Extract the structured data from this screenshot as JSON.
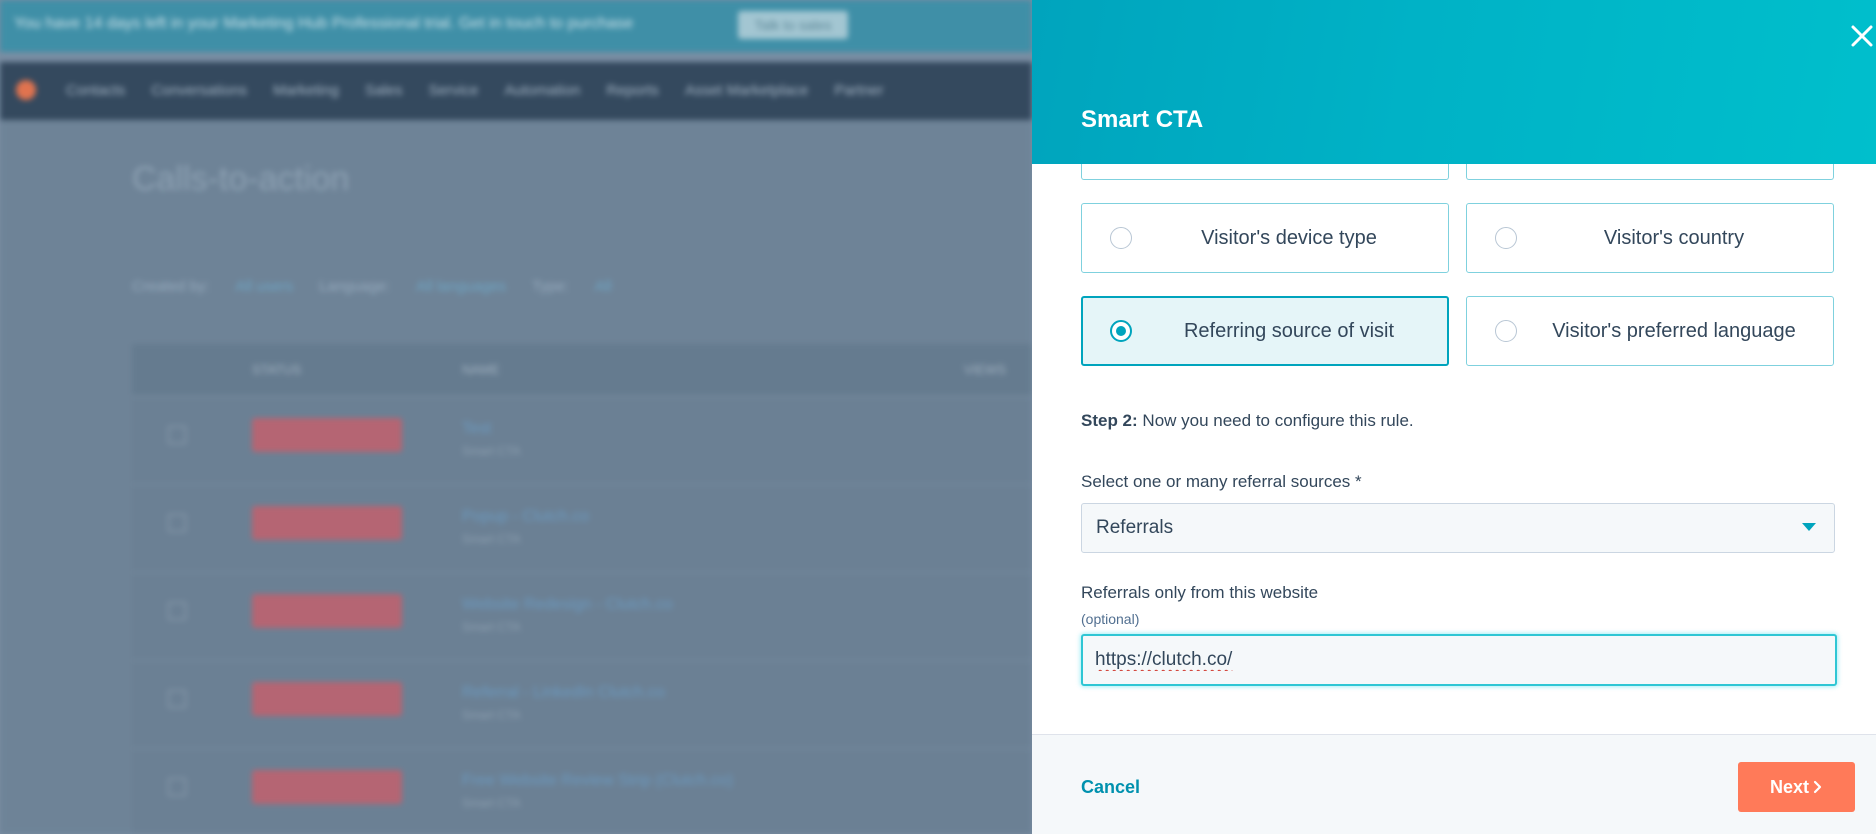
{
  "background": {
    "banner_text": "You have 14 days left in your Marketing Hub Professional trial. Get in touch to purchase",
    "banner_button": "Talk to sales",
    "nav_items": [
      "Contacts",
      "Conversations",
      "Marketing",
      "Sales",
      "Service",
      "Automation",
      "Reports",
      "Asset Marketplace",
      "Partner"
    ],
    "page_title": "Calls-to-action",
    "filters": [
      "Created by:",
      "All users",
      "Language:",
      "All languages",
      "Type:",
      "All"
    ],
    "table_headers": [
      "STATUS",
      "NAME",
      "VIEWS"
    ],
    "rows": [
      {
        "name": "Test",
        "sub": "Smart CTA"
      },
      {
        "name": "Popup - Clutch.co",
        "sub": "Smart CTA"
      },
      {
        "name": "Website Redesign - Clutch.co",
        "sub": "Smart CTA"
      },
      {
        "name": "Referral - LinkedIn Clutch.co",
        "sub": "Smart CTA"
      },
      {
        "name": "Free Website Review Strip (Clutch.co)",
        "sub": "Smart CTA"
      }
    ]
  },
  "panel": {
    "title": "Smart CTA",
    "close_icon": "close-icon",
    "rule_options": [
      {
        "label": "",
        "selected": false
      },
      {
        "label": "",
        "selected": false
      },
      {
        "label": "Visitor's device type",
        "selected": false
      },
      {
        "label": "Visitor's country",
        "selected": false
      },
      {
        "label": "Referring source of visit",
        "selected": true
      },
      {
        "label": "Visitor's preferred language",
        "selected": false
      }
    ],
    "step2": {
      "prefix": "Step 2:",
      "text": " Now you need to configure this rule."
    },
    "referral_select": {
      "label": "Select one or many referral sources *",
      "value": "Referrals"
    },
    "website_field": {
      "label": "Referrals only from this website",
      "hint": "(optional)",
      "value": "https://clutch.co/"
    },
    "footer": {
      "cancel_label": "Cancel",
      "next_label": "Next"
    },
    "colors": {
      "header_gradient_start": "#00a4bd",
      "header_gradient_end": "#00bfcc",
      "accent": "#00a4bd",
      "primary_button": "#ff7a59",
      "text": "#33475b"
    }
  }
}
